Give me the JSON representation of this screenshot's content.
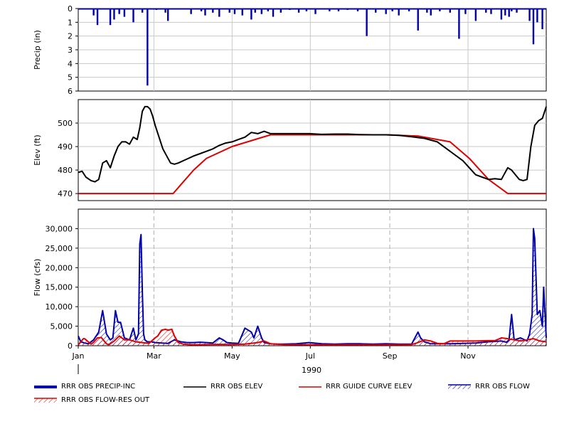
{
  "chart_data": [
    {
      "type": "bar",
      "panel": "precip",
      "ylabel": "Precip (in)",
      "ylim": [
        0,
        6
      ],
      "inverted": true,
      "yticks": [
        "0",
        "1",
        "2",
        "3",
        "4",
        "5",
        "6"
      ],
      "xlim_days": [
        0,
        365
      ],
      "series": [
        {
          "name": "RRR OBS PRECIP-INC",
          "color": "#0000aa",
          "days": [
            12,
            15,
            25,
            28,
            32,
            36,
            43,
            50,
            54,
            61,
            68,
            70,
            88,
            96,
            99,
            105,
            110,
            118,
            122,
            128,
            135,
            138,
            143,
            148,
            152,
            158,
            165,
            172,
            178,
            185,
            196,
            203,
            210,
            218,
            225,
            232,
            240,
            245,
            250,
            258,
            265,
            272,
            275,
            282,
            290,
            297,
            302,
            310,
            318,
            322,
            330,
            333,
            336,
            338,
            342,
            352,
            355,
            358,
            362
          ],
          "values": [
            0.5,
            1.2,
            1.2,
            0.8,
            0.4,
            0.6,
            1.0,
            0.3,
            5.6,
            0.1,
            0.3,
            0.9,
            0.4,
            0.2,
            0.5,
            0.3,
            0.6,
            0.3,
            0.4,
            0.5,
            0.8,
            0.3,
            0.4,
            0.2,
            0.6,
            0.3,
            0.1,
            0.3,
            0.2,
            0.4,
            0.2,
            0.2,
            0.1,
            0.2,
            2.0,
            0.3,
            0.4,
            0.2,
            0.5,
            0.2,
            1.6,
            0.3,
            0.5,
            0.2,
            0.3,
            2.2,
            0.4,
            0.9,
            0.3,
            0.4,
            0.8,
            0.5,
            0.6,
            0.2,
            0.3,
            0.9,
            2.6,
            1.0,
            1.5
          ]
        }
      ]
    },
    {
      "type": "line",
      "panel": "elev",
      "ylabel": "Elev (ft)",
      "ylim": [
        467,
        510
      ],
      "yticks": [
        470,
        480,
        490,
        500
      ],
      "xlim_days": [
        0,
        365
      ],
      "series": [
        {
          "name": "RRR OBS ELEV",
          "color": "#000000",
          "x": [
            0,
            3,
            6,
            10,
            13,
            16,
            19,
            22,
            25,
            28,
            31,
            34,
            37,
            40,
            43,
            46,
            48,
            50,
            52,
            54,
            56,
            58,
            60,
            63,
            66,
            69,
            72,
            75,
            78,
            82,
            86,
            90,
            95,
            100,
            105,
            110,
            115,
            120,
            125,
            130,
            135,
            140,
            145,
            150,
            160,
            170,
            180,
            190,
            200,
            210,
            220,
            230,
            240,
            250,
            260,
            270,
            280,
            290,
            300,
            305,
            310,
            315,
            320,
            325,
            330,
            332,
            335,
            338,
            341,
            344,
            347,
            350,
            353,
            356,
            359,
            362,
            365
          ],
          "y": [
            479,
            479.5,
            477,
            475.5,
            475,
            476,
            483,
            484,
            481,
            486,
            490,
            492,
            492,
            491,
            494,
            493,
            498,
            505,
            507,
            507,
            506,
            503,
            499,
            494,
            489,
            486,
            483,
            482.5,
            483,
            484,
            485,
            486,
            487,
            488,
            489,
            490.5,
            491.5,
            492,
            493,
            494,
            496,
            495.5,
            496.5,
            495.5,
            495.5,
            495.5,
            495.5,
            495.2,
            495.3,
            495.3,
            495.1,
            495.0,
            495.0,
            494.8,
            494.2,
            493.5,
            492,
            488,
            484,
            481,
            478,
            477,
            476,
            476.3,
            476,
            478,
            481,
            480,
            478,
            476,
            475.5,
            476,
            490,
            499,
            501,
            502,
            507
          ]
        },
        {
          "name": "RRR GUIDE CURVE ELEV",
          "color": "#dd0000",
          "x": [
            0,
            74,
            90,
            100,
            120,
            150,
            180,
            210,
            240,
            265,
            275,
            290,
            305,
            320,
            335,
            365
          ],
          "y": [
            470,
            470,
            480,
            485,
            490,
            495,
            495,
            495,
            495,
            494.5,
            493.5,
            492,
            485,
            476,
            470,
            470
          ]
        }
      ]
    },
    {
      "type": "line",
      "panel": "flow",
      "ylabel": "Flow (cfs)",
      "ylim": [
        0,
        35000
      ],
      "yticks": [
        "0",
        "5,000",
        "10,000",
        "15,000",
        "20,000",
        "25,000",
        "30,000"
      ],
      "xlim_days": [
        0,
        365
      ],
      "series": [
        {
          "name": "RRR OBS FLOW",
          "color": "#0000aa",
          "x": [
            0,
            2,
            5,
            8,
            12,
            16,
            19,
            22,
            25,
            27,
            29,
            31,
            33,
            36,
            40,
            43,
            45,
            47,
            48,
            49,
            50,
            51,
            52,
            54,
            57,
            60,
            65,
            70,
            75,
            80,
            85,
            90,
            95,
            100,
            105,
            110,
            113,
            116,
            120,
            125,
            130,
            135,
            137,
            140,
            143,
            145,
            150,
            155,
            160,
            170,
            180,
            190,
            200,
            210,
            220,
            230,
            240,
            250,
            260,
            265,
            267,
            270,
            275,
            280,
            290,
            300,
            310,
            320,
            330,
            334,
            336,
            338,
            340,
            345,
            350,
            352,
            354,
            355,
            356,
            358,
            360,
            362,
            363,
            365
          ],
          "y": [
            2500,
            1000,
            700,
            500,
            1500,
            3500,
            9000,
            3000,
            1500,
            2000,
            9000,
            6000,
            6000,
            2000,
            1500,
            4500,
            1500,
            3000,
            26000,
            28500,
            14000,
            3000,
            1500,
            1000,
            1000,
            800,
            700,
            600,
            1500,
            1000,
            800,
            800,
            900,
            800,
            700,
            2000,
            1500,
            800,
            700,
            600,
            4500,
            3500,
            2000,
            5000,
            2000,
            800,
            500,
            400,
            400,
            500,
            800,
            500,
            400,
            500,
            500,
            400,
            500,
            400,
            400,
            3500,
            2000,
            1000,
            500,
            500,
            500,
            600,
            700,
            1000,
            1200,
            900,
            1500,
            8000,
            1500,
            2000,
            1200,
            3000,
            8000,
            30000,
            27500,
            8000,
            9000,
            5000,
            15000,
            2000
          ]
        },
        {
          "name": "RRR OBS FLOW-RES OUT",
          "color": "#dd0000",
          "x": [
            0,
            4,
            5,
            10,
            12,
            15,
            18,
            22,
            24,
            28,
            32,
            36,
            40,
            45,
            50,
            55,
            60,
            62,
            65,
            68,
            70,
            73,
            75,
            78,
            82,
            86,
            90,
            95,
            100,
            110,
            120,
            130,
            140,
            145,
            150,
            160,
            180,
            200,
            220,
            240,
            260,
            265,
            270,
            275,
            280,
            285,
            290,
            300,
            310,
            320,
            325,
            330,
            335,
            340,
            345,
            350,
            355,
            360,
            365
          ],
          "y": [
            200,
            1800,
            1800,
            400,
            900,
            2000,
            2100,
            500,
            300,
            1200,
            2500,
            1500,
            1500,
            1000,
            800,
            600,
            2000,
            2500,
            4000,
            4200,
            4000,
            4200,
            2500,
            800,
            400,
            300,
            250,
            250,
            300,
            350,
            300,
            400,
            800,
            1200,
            500,
            300,
            250,
            250,
            250,
            250,
            300,
            800,
            1500,
            1200,
            600,
            500,
            1200,
            1200,
            1200,
            1300,
            1300,
            2000,
            1800,
            1500,
            1200,
            1500,
            1800,
            1200,
            1000
          ]
        }
      ]
    }
  ],
  "x_axis": {
    "ticks": [
      {
        "label": "Jan",
        "day": 0
      },
      {
        "label": "Mar",
        "day": 59
      },
      {
        "label": "May",
        "day": 120
      },
      {
        "label": "Jul",
        "day": 181
      },
      {
        "label": "Sep",
        "day": 243
      },
      {
        "label": "Nov",
        "day": 304
      }
    ],
    "year_label": "1990"
  },
  "legend": {
    "items": [
      {
        "label": "RRR OBS PRECIP-INC",
        "color": "#0000aa",
        "style": "thick"
      },
      {
        "label": "RRR OBS ELEV",
        "color": "#000000",
        "style": "line"
      },
      {
        "label": "RRR GUIDE CURVE ELEV",
        "color": "#dd0000",
        "style": "line"
      },
      {
        "label": "RRR OBS FLOW",
        "color": "#0000aa",
        "style": "hatch"
      },
      {
        "label": "RRR OBS FLOW-RES OUT",
        "color": "#dd0000",
        "style": "hatch"
      }
    ]
  }
}
